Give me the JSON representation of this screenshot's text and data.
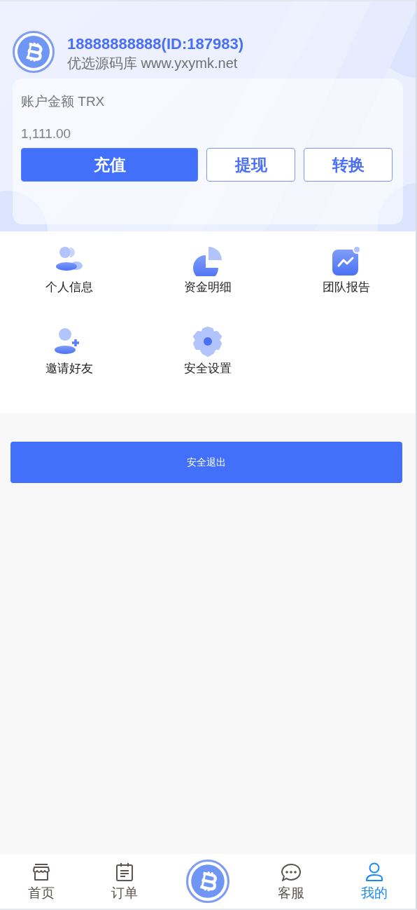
{
  "profile": {
    "account": "18888888888(ID:187983)",
    "subtitle": "优选源码库 www.yxymk.net"
  },
  "balance": {
    "label": "账户金额 TRX",
    "amount": "1,111.00"
  },
  "actions": [
    {
      "label": "充值",
      "kind": "primary"
    },
    {
      "label": "提现",
      "kind": "outline"
    },
    {
      "label": "转换",
      "kind": "outline"
    }
  ],
  "menu": [
    {
      "label": "个人信息"
    },
    {
      "label": "资金明细"
    },
    {
      "label": "团队报告"
    },
    {
      "label": "邀请好友"
    },
    {
      "label": "安全设置"
    }
  ],
  "logout": "安全退出",
  "tabs": [
    {
      "kind": "tab",
      "label": "首页",
      "selected": false
    },
    {
      "kind": "tab",
      "label": "订单",
      "selected": false
    },
    {
      "kind": "logo",
      "selected": false
    },
    {
      "kind": "tab",
      "label": "客服",
      "selected": false
    },
    {
      "kind": "tab",
      "label": "我的",
      "selected": true
    }
  ]
}
